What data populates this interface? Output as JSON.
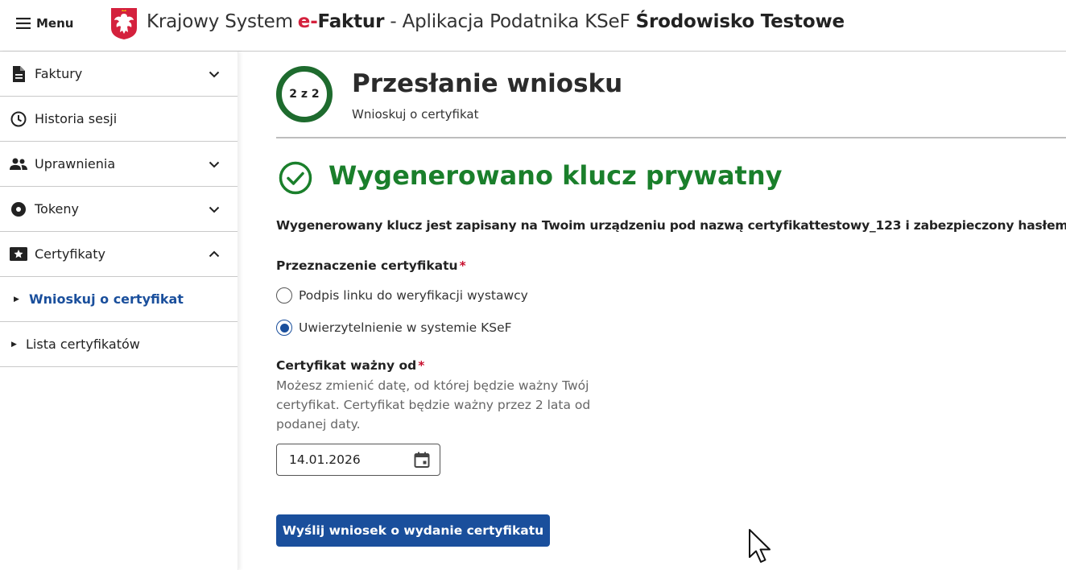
{
  "header": {
    "menu_label": "Menu",
    "title_prefix": "Krajowy System",
    "title_e": "e-",
    "title_faktur": "Faktur",
    "title_middle": " - Aplikacja Podatnika KSeF ",
    "title_env": "Środowisko Testowe"
  },
  "sidebar": {
    "items": [
      {
        "label": "Faktury",
        "icon": "document-icon",
        "expandable": true,
        "expanded": false
      },
      {
        "label": "Historia sesji",
        "icon": "clock-icon",
        "expandable": false
      },
      {
        "label": "Uprawnienia",
        "icon": "people-icon",
        "expandable": true,
        "expanded": false
      },
      {
        "label": "Tokeny",
        "icon": "token-icon",
        "expandable": true,
        "expanded": false
      },
      {
        "label": "Certyfikaty",
        "icon": "certificate-icon",
        "expandable": true,
        "expanded": true
      }
    ],
    "subitems": [
      {
        "label": "Wnioskuj o certyfikat",
        "active": true
      },
      {
        "label": "Lista certyfikatów",
        "active": false
      }
    ]
  },
  "main": {
    "step": "2 z 2",
    "title": "Przesłanie wniosku",
    "subtitle": "Wnioskuj o certyfikat",
    "success_title": "Wygenerowano klucz prywatny",
    "info_text": "Wygenerowany klucz jest zapisany na Twoim urządzeniu pod nazwą certyfikattestowy_123 i zabezpieczony hasłem",
    "purpose_label": "Przeznaczenie certyfikatu",
    "required_mark": "*",
    "purpose_options": [
      {
        "label": "Podpis linku do weryfikacji wystawcy",
        "checked": false
      },
      {
        "label": "Uwierzytelnienie w systemie KSeF",
        "checked": true
      }
    ],
    "valid_from_label": "Certyfikat ważny od",
    "valid_from_help": "Możesz zmienić datę, od której będzie ważny Twój certyfikat. Certyfikat będzie ważny przez 2 lata od podanej daty.",
    "valid_from_value": "14.01.2026",
    "submit_label": "Wyślij wniosek o wydanie certyfikatu"
  },
  "colors": {
    "primary": "#1a4f9c",
    "success": "#1a7f2b",
    "step_ring": "#1e6b2e",
    "brand_red": "#d4213d"
  }
}
